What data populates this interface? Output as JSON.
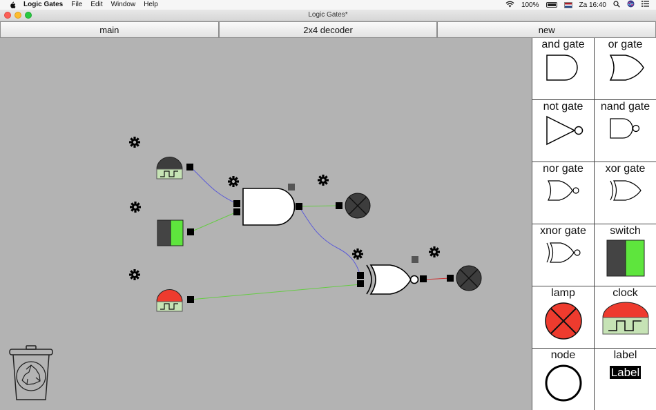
{
  "menubar": {
    "app_name": "Logic Gates",
    "menus": [
      "File",
      "Edit",
      "Window",
      "Help"
    ],
    "battery_text": "100%",
    "clock": "Za 16:40"
  },
  "window": {
    "title": "Logic Gates*"
  },
  "tabs": [
    {
      "label": "main"
    },
    {
      "label": "2x4 decoder"
    },
    {
      "label": "new"
    }
  ],
  "palette": [
    {
      "label": "and gate",
      "icon": "and-gate-icon"
    },
    {
      "label": "or gate",
      "icon": "or-gate-icon"
    },
    {
      "label": "not gate",
      "icon": "not-gate-icon"
    },
    {
      "label": "nand gate",
      "icon": "nand-gate-icon"
    },
    {
      "label": "nor gate",
      "icon": "nor-gate-icon"
    },
    {
      "label": "xor gate",
      "icon": "xor-gate-icon"
    },
    {
      "label": "xnor gate",
      "icon": "xnor-gate-icon"
    },
    {
      "label": "switch",
      "icon": "switch-icon"
    },
    {
      "label": "lamp",
      "icon": "lamp-icon"
    },
    {
      "label": "clock",
      "icon": "clock-icon"
    },
    {
      "label": "node",
      "icon": "node-icon"
    },
    {
      "label": "label",
      "icon": "label-icon",
      "sample_text": "Label"
    }
  ],
  "colors": {
    "canvas_bg": "#b3b3b3",
    "on_green": "#5ee53d",
    "off_dark": "#444444",
    "clock_red": "#ee3b2e",
    "clock_base": "#c6e3b5",
    "wire_blue": "#5a5ad8",
    "wire_green": "#66cc44",
    "wire_red": "#cc3333"
  }
}
